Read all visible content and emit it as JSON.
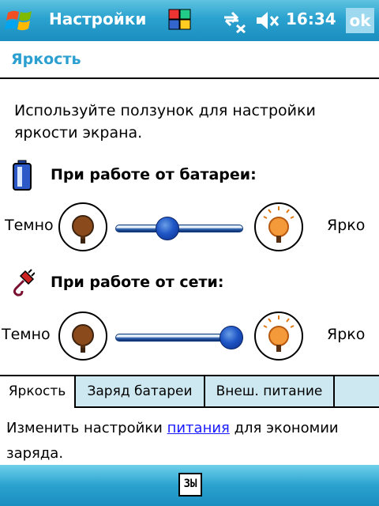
{
  "titlebar": {
    "title": "Настройки",
    "clock": "16:34",
    "ok_label": "ok",
    "icons": [
      "windows-start-icon",
      "apps-icon",
      "connectivity-icon",
      "volume-muted-icon"
    ]
  },
  "page": {
    "title": "Яркость",
    "instructions": "Используйте ползунок для настройки яркости экрана."
  },
  "battery": {
    "label": "При работе от батареи:",
    "dark_label": "Темно",
    "bright_label": "Ярко",
    "level": 0.3
  },
  "external": {
    "label": "При работе от сети:",
    "dark_label": "Темно",
    "bright_label": "Ярко",
    "level": 1.0
  },
  "tabs": [
    {
      "label": "Яркость",
      "active": true
    },
    {
      "label": "Заряд батареи",
      "active": false
    },
    {
      "label": "Внеш. питание",
      "active": false
    }
  ],
  "footer": {
    "text_before": "Изменить настройки ",
    "link": "питания",
    "text_after": " для экономии заряда."
  },
  "cmdbar": {
    "keyboard_label": "ЗЫ"
  },
  "colors": {
    "titlebar": "#2aa2cf",
    "accent_text": "#2a9fd0",
    "tabs_bg": "#cde8f1",
    "slider_thumb": "#1f56c6"
  }
}
